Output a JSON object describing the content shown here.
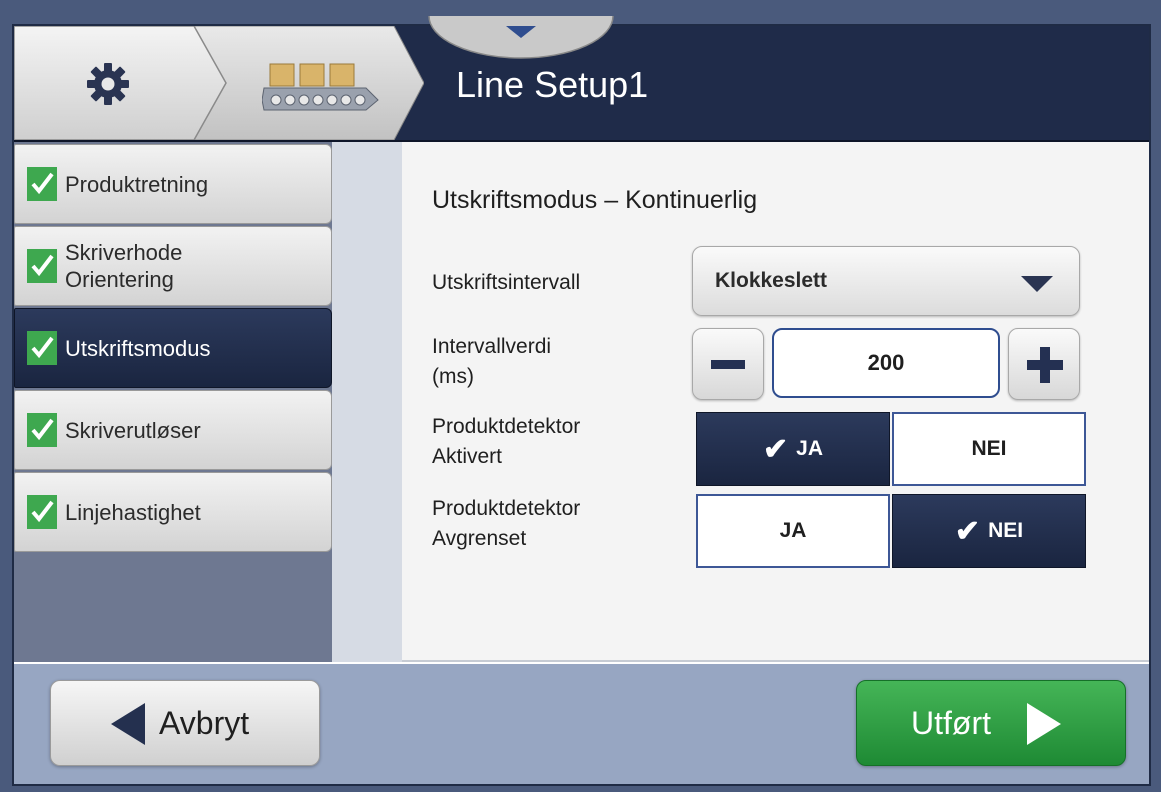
{
  "header": {
    "title": "Line Setup1",
    "breadcrumb": [
      "gear-icon",
      "conveyor-icon"
    ]
  },
  "sidebar": {
    "items": [
      {
        "label": "Produktretning",
        "checked": true,
        "active": false
      },
      {
        "label": "Skriverhode Orientering",
        "checked": true,
        "active": false
      },
      {
        "label": "Utskriftsmodus",
        "checked": true,
        "active": true
      },
      {
        "label": "Skriverutløser",
        "checked": true,
        "active": false
      },
      {
        "label": "Linjehastighet",
        "checked": true,
        "active": false
      }
    ]
  },
  "main": {
    "section_title": "Utskriftsmodus – Kontinuerlig",
    "print_interval": {
      "label": "Utskriftsintervall",
      "value": "Klokkeslett"
    },
    "interval_value": {
      "label_line1": "Intervallverdi",
      "label_line2": "(ms)",
      "value": "200"
    },
    "detector_enabled": {
      "label_line1": "Produktdetektor",
      "label_line2": "Aktivert",
      "yes_label": "JA",
      "no_label": "NEI",
      "selected": "yes"
    },
    "detector_limited": {
      "label_line1": "Produktdetektor",
      "label_line2": "Avgrenset",
      "yes_label": "JA",
      "no_label": "NEI",
      "selected": "no"
    }
  },
  "footer": {
    "cancel_label": "Avbryt",
    "done_label": "Utført"
  },
  "colors": {
    "header_bg": "#1f2b49",
    "active_item": "#1a2540",
    "check_green": "#3ea84f",
    "done_green": "#2e9e44"
  }
}
